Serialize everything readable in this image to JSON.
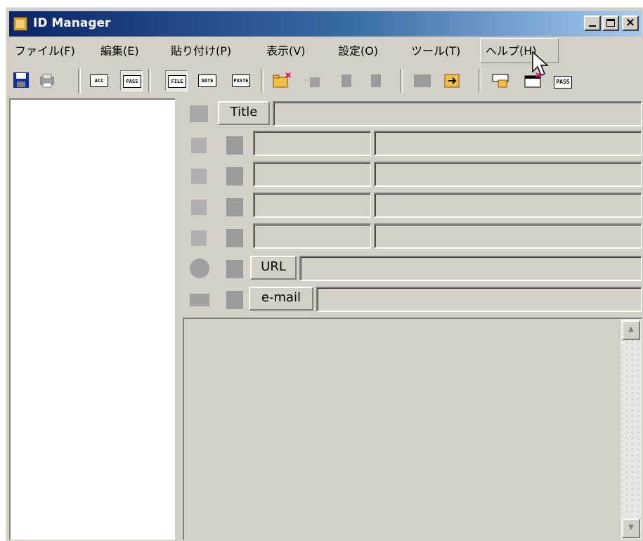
{
  "window": {
    "title": "ID Manager"
  },
  "caption_buttons": {
    "minimize": "_",
    "maximize": "□",
    "close": "×"
  },
  "menu": [
    {
      "label": "ファイル(F)"
    },
    {
      "label": "編集(E)"
    },
    {
      "label": "貼り付け(P)"
    },
    {
      "label": "表示(V)"
    },
    {
      "label": "設定(O)"
    },
    {
      "label": "ツール(T)"
    },
    {
      "label": "ヘルプ(H)"
    }
  ],
  "toolbar": {
    "acc_text": "ACC +++",
    "pass_text": "PASS +++",
    "file_text": "FILE",
    "date_text": "DATE",
    "paste_text": "PASTE",
    "pass_small_text": "PASS"
  },
  "form": {
    "title_label": "Title",
    "url_label": "URL",
    "email_label": "e-mail",
    "title_value": "",
    "url_value": "",
    "email_value": ""
  },
  "icons": {
    "save": "floppy-disk-icon",
    "print": "printer-icon"
  },
  "colors": {
    "titlebar_start": "#0a246a",
    "titlebar_end": "#a6caf0",
    "face": "#d4d0c8"
  }
}
